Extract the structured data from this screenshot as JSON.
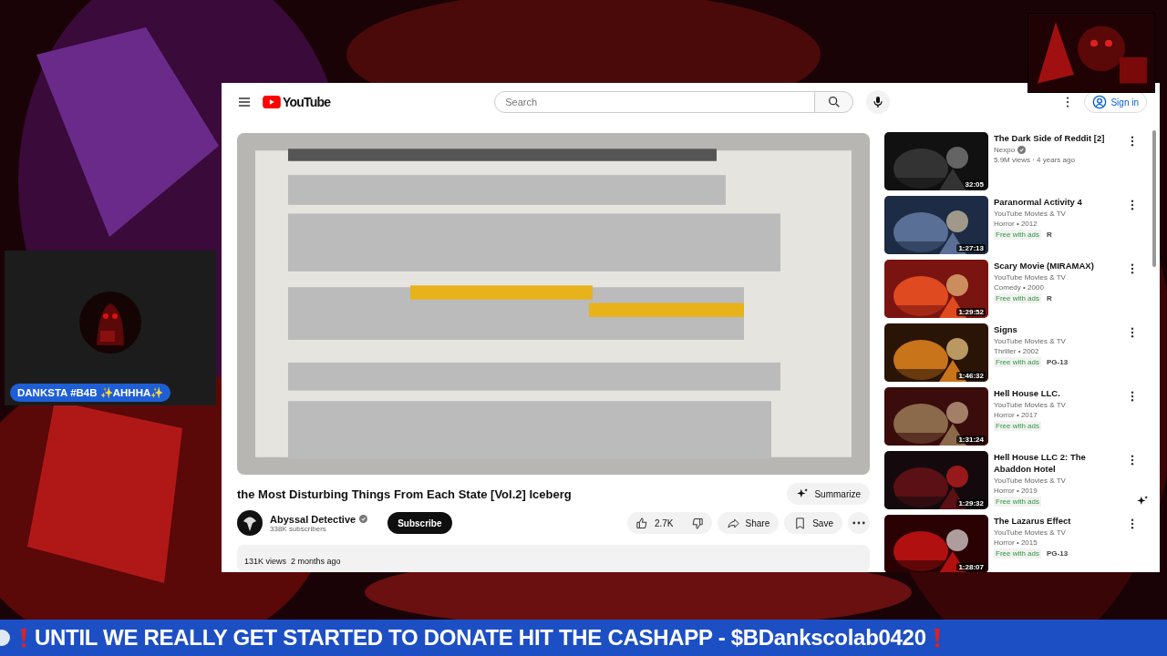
{
  "camera": {
    "caption": "DANKSTA #B4B ✨AHHHA✨"
  },
  "header": {
    "logo": "YouTube",
    "search": {
      "placeholder": "Search"
    },
    "sign_in": "Sign in"
  },
  "video": {
    "kind": "picture",
    "title": "the Most Disturbing Things From Each State [Vol.2] Iceberg",
    "summarize": "Summarize",
    "channel": "Abyssal Detective",
    "verified": true,
    "subscribers": "338K subscribers",
    "subscribe": "Subscribe",
    "likes": "2.7K",
    "share": "Share",
    "save": "Save",
    "description": "131K views  2 months ago"
  },
  "recommendations": [
    {
      "title": "The Dark Side of Reddit [2]",
      "channel": "Nexpo",
      "verified": true,
      "meta": "5.9M views · 4 years ago",
      "duration": "32:05"
    },
    {
      "title": "Paranormal Activity 4",
      "channel": "YouTube Movies & TV",
      "verified": false,
      "meta": "Horror • 2012",
      "duration": "1:27:13",
      "badges": [
        {
          "text": "Free with ads",
          "kind": "offer"
        },
        {
          "text": "R",
          "kind": "rating"
        }
      ]
    },
    {
      "title": "Scary Movie (MIRAMAX)",
      "channel": "YouTube Movies & TV",
      "verified": false,
      "meta": "Comedy • 2000",
      "duration": "1:29:52",
      "badges": [
        {
          "text": "Free with ads",
          "kind": "offer"
        },
        {
          "text": "R",
          "kind": "rating"
        }
      ]
    },
    {
      "title": "Signs",
      "channel": "YouTube Movies & TV",
      "verified": false,
      "meta": "Thriller • 2002",
      "duration": "1:46:32",
      "badges": [
        {
          "text": "Free with ads",
          "kind": "offer"
        },
        {
          "text": "PG-13",
          "kind": "rating"
        }
      ]
    },
    {
      "title": "Hell House LLC.",
      "channel": "YouTube Movies & TV",
      "verified": false,
      "meta": "Horror • 2017",
      "duration": "1:31:24",
      "badges": [
        {
          "text": "Free with ads",
          "kind": "offer"
        }
      ]
    },
    {
      "title": "Hell House LLC 2: The Abaddon Hotel",
      "channel": "YouTube Movies & TV",
      "verified": false,
      "meta": "Horror • 2019",
      "duration": "1:29:32",
      "badges": [
        {
          "text": "Free with ads",
          "kind": "offer"
        }
      ]
    },
    {
      "title": "The Lazarus Effect",
      "channel": "YouTube Movies & TV",
      "verified": false,
      "meta": "Horror • 2015",
      "duration": "1:28:07",
      "badges": [
        {
          "text": "Free with ads",
          "kind": "offer"
        },
        {
          "text": "PG-13",
          "kind": "rating"
        }
      ]
    }
  ],
  "ticker": {
    "text": "UNTIL WE REALLY GET STARTED TO DONATE HIT THE CASHAPP - $BDankscolab0420"
  }
}
